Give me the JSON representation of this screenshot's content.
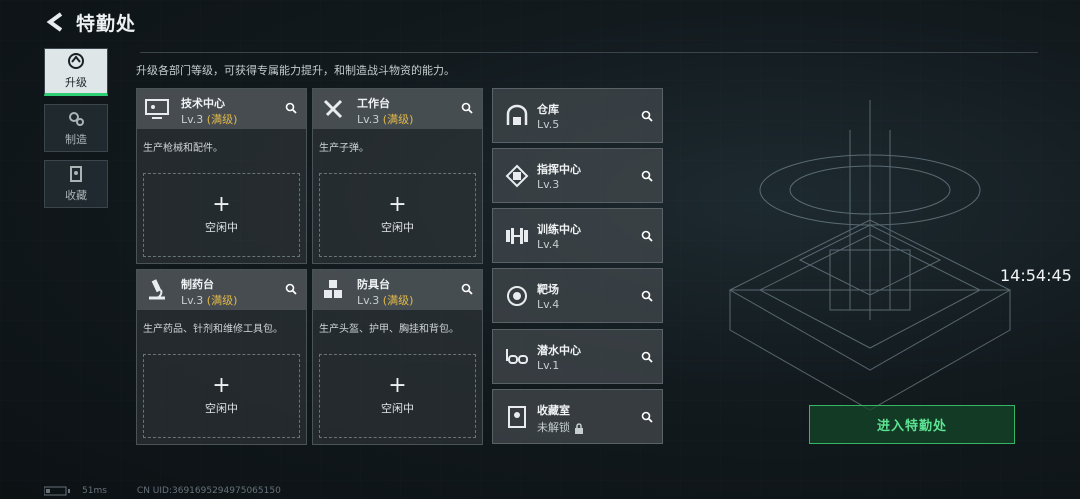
{
  "header": {
    "title": "特勤处"
  },
  "subtitle": "升级各部门等级，可获得专属能力提升，和制造战斗物资的能力。",
  "nav": [
    {
      "label": "升级",
      "icon": "upgrade-icon"
    },
    {
      "label": "制造",
      "icon": "gears-icon"
    },
    {
      "label": "收藏",
      "icon": "collection-icon"
    }
  ],
  "departments": [
    {
      "name": "技术中心",
      "level": "Lv.3",
      "status": "(满级)",
      "desc": "生产枪械和配件。",
      "slot": "空闲中",
      "icon": "computer-icon"
    },
    {
      "name": "工作台",
      "level": "Lv.3",
      "status": "(满级)",
      "desc": "生产子弹。",
      "slot": "空闲中",
      "icon": "tools-icon"
    },
    {
      "name": "制药台",
      "level": "Lv.3",
      "status": "(满级)",
      "desc": "生产药品、针剂和维修工具包。",
      "slot": "空闲中",
      "icon": "microscope-icon"
    },
    {
      "name": "防具台",
      "level": "Lv.3",
      "status": "(满级)",
      "desc": "生产头盔、护甲、胸挂和背包。",
      "slot": "空闲中",
      "icon": "cubes-icon"
    }
  ],
  "facilities": [
    {
      "name": "仓库",
      "level": "Lv.5",
      "icon": "warehouse-icon"
    },
    {
      "name": "指挥中心",
      "level": "Lv.3",
      "icon": "command-icon"
    },
    {
      "name": "训练中心",
      "level": "Lv.4",
      "icon": "dumbbell-icon"
    },
    {
      "name": "靶场",
      "level": "Lv.4",
      "icon": "target-icon"
    },
    {
      "name": "潜水中心",
      "level": "Lv.1",
      "icon": "goggles-icon"
    },
    {
      "name": "收藏室",
      "level": "未解锁",
      "icon": "vault-icon"
    }
  ],
  "time": "14:54:45",
  "enter_button": "进入特勤处",
  "footer": {
    "ping": "51ms",
    "uid": "CN UID:3691695294975065150"
  },
  "colors": {
    "accent_green": "#2fcf76",
    "maxed_gold": "#e0b84a"
  }
}
